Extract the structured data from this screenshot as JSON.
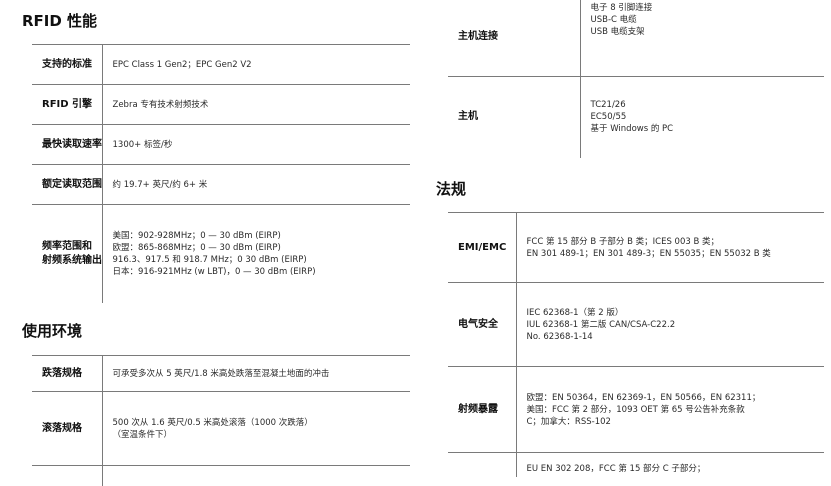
{
  "rfid": {
    "title": "RFID 性能",
    "rows": [
      {
        "key": [
          "支持的标准"
        ],
        "values": [
          "EPC Class 1 Gen2；EPC Gen2 V2"
        ]
      },
      {
        "key": [
          "RFID 引擎"
        ],
        "values": [
          "Zebra 专有技术射频技术"
        ]
      },
      {
        "key": [
          "最快读取速率"
        ],
        "values": [
          "1300+ 标签/秒"
        ]
      },
      {
        "key": [
          "额定读取范围"
        ],
        "values": [
          "约 19.7+ 英尺/约 6+ 米"
        ]
      },
      {
        "key": [
          "频率范围和",
          "射频系统输出"
        ],
        "values": [
          "美国：902-928MHz；0 — 30 dBm (EIRP)",
          "欧盟：865-868MHz；0 — 30 dBm (EIRP)",
          "916.3、917.5 和 918.7 MHz；0 30 dBm (EIRP)",
          "日本：916-921MHz (w LBT)，0 — 30 dBm (EIRP)"
        ]
      }
    ]
  },
  "environment": {
    "title": "使用环境",
    "rows": [
      {
        "key": [
          "跌落规格"
        ],
        "values": [
          "可承受多次从 5 英尺/1.8 米高处跌落至混凝土地面的冲击"
        ]
      },
      {
        "key": [
          "滚落规格"
        ],
        "values": [
          "500 次从 1.6 英尺/0.5 米高处滚落（1000 次跌落）",
          "（室温条件下）"
        ]
      },
      {
        "key": [
          ""
        ],
        "values": [
          ""
        ]
      }
    ]
  },
  "host": {
    "rows": [
      {
        "key": [
          "主机连接"
        ],
        "values": [
          "电子 8 引脚连接",
          "USB-C 电缆",
          "USB 电缆支架"
        ]
      },
      {
        "key": [
          "主机"
        ],
        "values": [
          "TC21/26",
          "EC50/55",
          "基于 Windows 的 PC"
        ]
      }
    ]
  },
  "regulatory": {
    "title": "法规",
    "rows": [
      {
        "key": [
          "EMI/EMC"
        ],
        "values": [
          "FCC 第 15 部分 B 子部分 B 类；ICES 003 B 类；",
          "EN 301 489-1；EN 301 489-3；EN 55035；EN 55032 B 类"
        ]
      },
      {
        "key": [
          "电气安全"
        ],
        "values": [
          "IEC 62368-1（第 2 版）",
          "IUL 62368-1 第二版 CAN/CSA-C22.2",
          "No. 62368-1-14"
        ]
      },
      {
        "key": [
          "射频暴露"
        ],
        "values": [
          "欧盟：EN 50364，EN 62369-1，EN 50566，EN 62311；",
          "美国：FCC 第 2 部分，1093 OET 第 65 号公告补充条款",
          "C；加拿大：RSS-102"
        ]
      },
      {
        "key": [
          ""
        ],
        "values": [
          "EU EN 302 208，FCC 第 15 部分 C 子部分；"
        ]
      }
    ]
  }
}
